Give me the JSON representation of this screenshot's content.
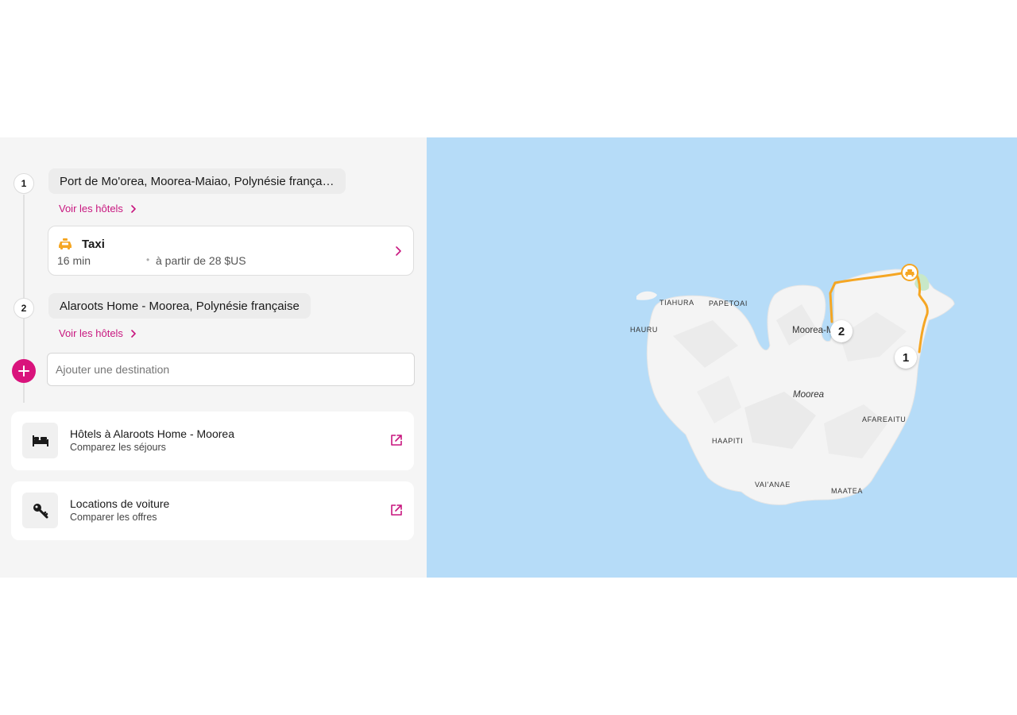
{
  "itinerary": {
    "stops": [
      {
        "number": "1",
        "place": "Port de Mo'orea, Moorea-Maiao, Polynésie frança…",
        "hotels_link": "Voir les hôtels"
      },
      {
        "number": "2",
        "place": "Alaroots Home - Moorea, Polynésie française",
        "hotels_link": "Voir les hôtels"
      }
    ],
    "segment": {
      "mode": "Taxi",
      "duration": "16 min",
      "separator": "•",
      "price": "à partir de 28 $US",
      "icon": "taxi-icon"
    },
    "add_destination": {
      "placeholder": "Ajouter une destination",
      "value": "",
      "icon": "plus-icon"
    }
  },
  "services": [
    {
      "title": "Hôtels à Alaroots Home - Moorea",
      "subtitle": "Comparez les séjours",
      "icon": "bed-icon",
      "action_icon": "external-link-icon"
    },
    {
      "title": "Locations de voiture",
      "subtitle": "Comparer les offres",
      "icon": "key-icon",
      "action_icon": "external-link-icon"
    }
  ],
  "map": {
    "island_name": "Moorea",
    "labels": [
      "TIAHURA",
      "PAPETOAI",
      "HAURU",
      "Moorea-M",
      "AFAREAITU",
      "HAAPITI",
      "VAI'ANAE",
      "MAATEA"
    ],
    "markers": [
      "1",
      "2"
    ],
    "route_color": "#f5a623",
    "water_color": "#b6dcf8"
  },
  "colors": {
    "accent": "#d9137c",
    "link": "#c8177f",
    "taxi": "#f5a623"
  }
}
